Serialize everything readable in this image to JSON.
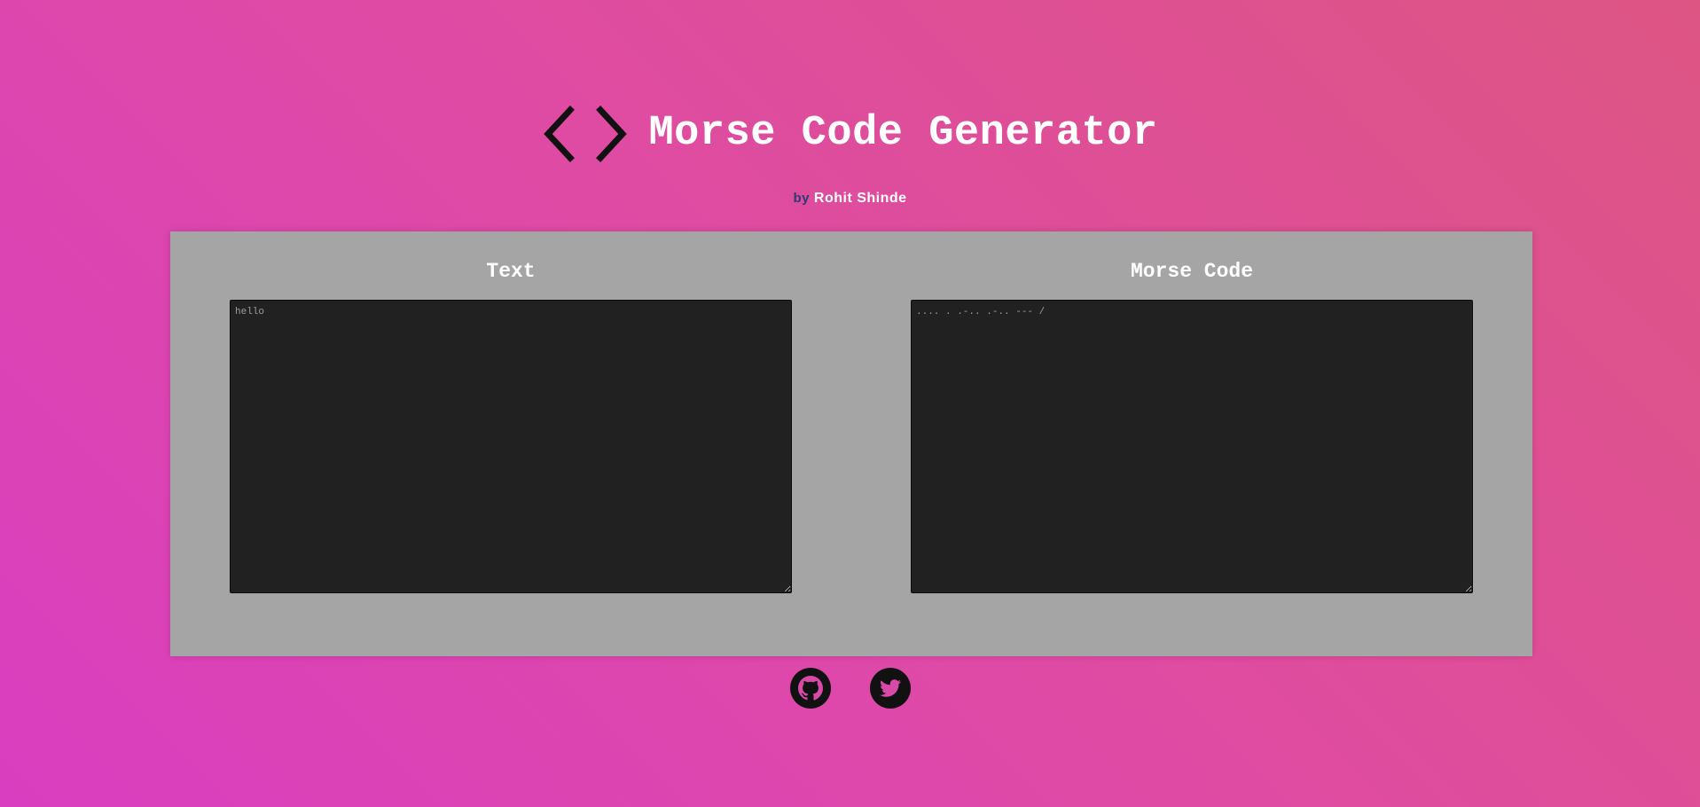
{
  "header": {
    "icon": "code-brackets-icon",
    "title": "Morse Code Generator"
  },
  "byline": {
    "by": "by",
    "author": "Rohit Shinde"
  },
  "converter": {
    "text_label": "Text",
    "text_value": "hello",
    "morse_label": "Morse Code",
    "morse_value": ".... . .-.. .-.. --- /"
  },
  "footer": {
    "links": [
      {
        "icon": "github-icon"
      },
      {
        "icon": "twitter-icon"
      }
    ]
  },
  "colors": {
    "panel": "#a5a5a5",
    "textarea_bg": "#212121",
    "title_text": "#ffffff",
    "byline_by": "#2b3b6f"
  }
}
